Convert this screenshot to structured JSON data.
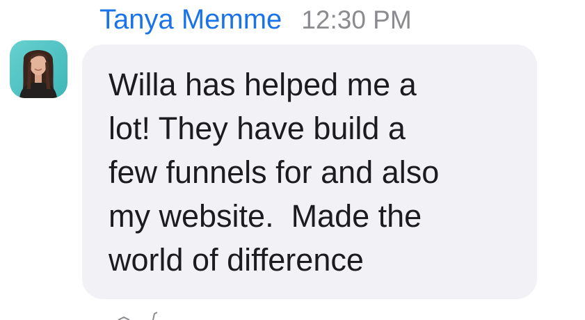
{
  "message": {
    "sender_name": "Tanya Memme",
    "timestamp": "12:30 PM",
    "body_lines": [
      "Willa has helped me a",
      "lot! They have build a",
      "few funnels for and also",
      "my website.  Made the",
      "world of difference"
    ],
    "avatar_icon": "profile-photo",
    "colors": {
      "sender_name": "#1a73e8",
      "timestamp": "#8a8a8f",
      "bubble_background": "#f1f1f6",
      "text": "#1c1c1e",
      "avatar_background": "#4fc3c3"
    }
  }
}
